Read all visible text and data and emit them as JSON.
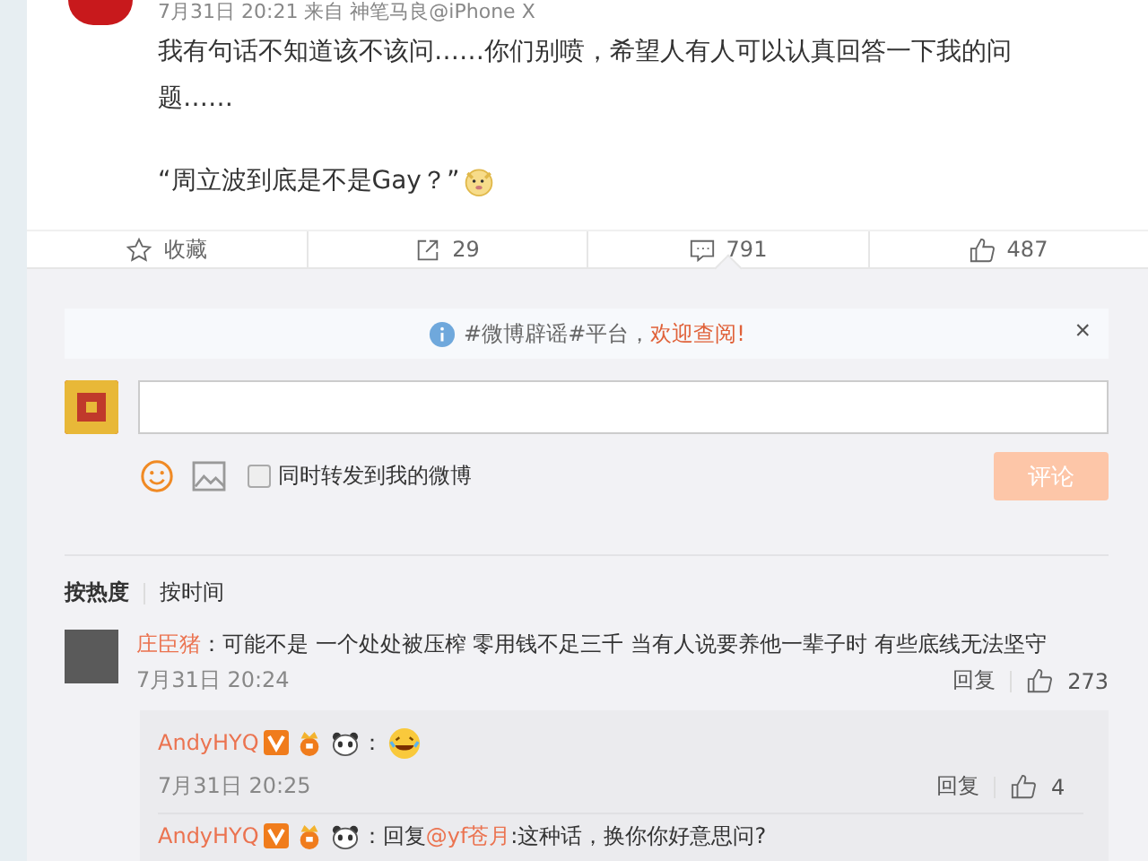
{
  "post": {
    "meta": "7月31日 20:21 来自 神笔马良@iPhone X",
    "paragraphs": [
      {
        "kind": "plain",
        "text": "我有句话不知道该不该问……你们别喷，希望人有人可以认真回答一下我的问题……"
      },
      {
        "kind": "emoji",
        "text": "“周立波到底是不是Gay？”"
      }
    ]
  },
  "actions": [
    {
      "kind": "star",
      "label": "收藏",
      "selected": false
    },
    {
      "kind": "share",
      "label": "29",
      "selected": false
    },
    {
      "kind": "comment",
      "label": "791",
      "selected": true
    },
    {
      "kind": "like",
      "label": "487",
      "selected": false
    }
  ],
  "notice": {
    "text": "#微博辟谣#平台，",
    "link": "欢迎查阅!",
    "close": "×"
  },
  "composer": {
    "repost_label": "同时转发到我的微博",
    "repost_checked": false,
    "submit": "评论",
    "submit_disabled": true
  },
  "sort": [
    {
      "label": "按热度",
      "selected": true
    },
    {
      "label": "按时间",
      "selected": false
    }
  ],
  "comments": [
    {
      "author": "庄臣猪",
      "text": "：可能不是 一个处处被压榨 零用钱不足三千 当有人说要养他一辈子时 有些底线无法坚守",
      "time": "7月31日 20:24",
      "reply": "回复",
      "likes": "273",
      "replies": [
        {
          "kind": "emoji",
          "author": "AndyHYQ",
          "prefix": "：",
          "time": "7月31日 20:25",
          "reply": "回复",
          "likes": "4"
        },
        {
          "kind": "mention",
          "author": "AndyHYQ",
          "prefix": "：回复",
          "mention": "@yf苍月",
          "text": ":这种话，换你你好意思问?"
        }
      ]
    }
  ]
}
